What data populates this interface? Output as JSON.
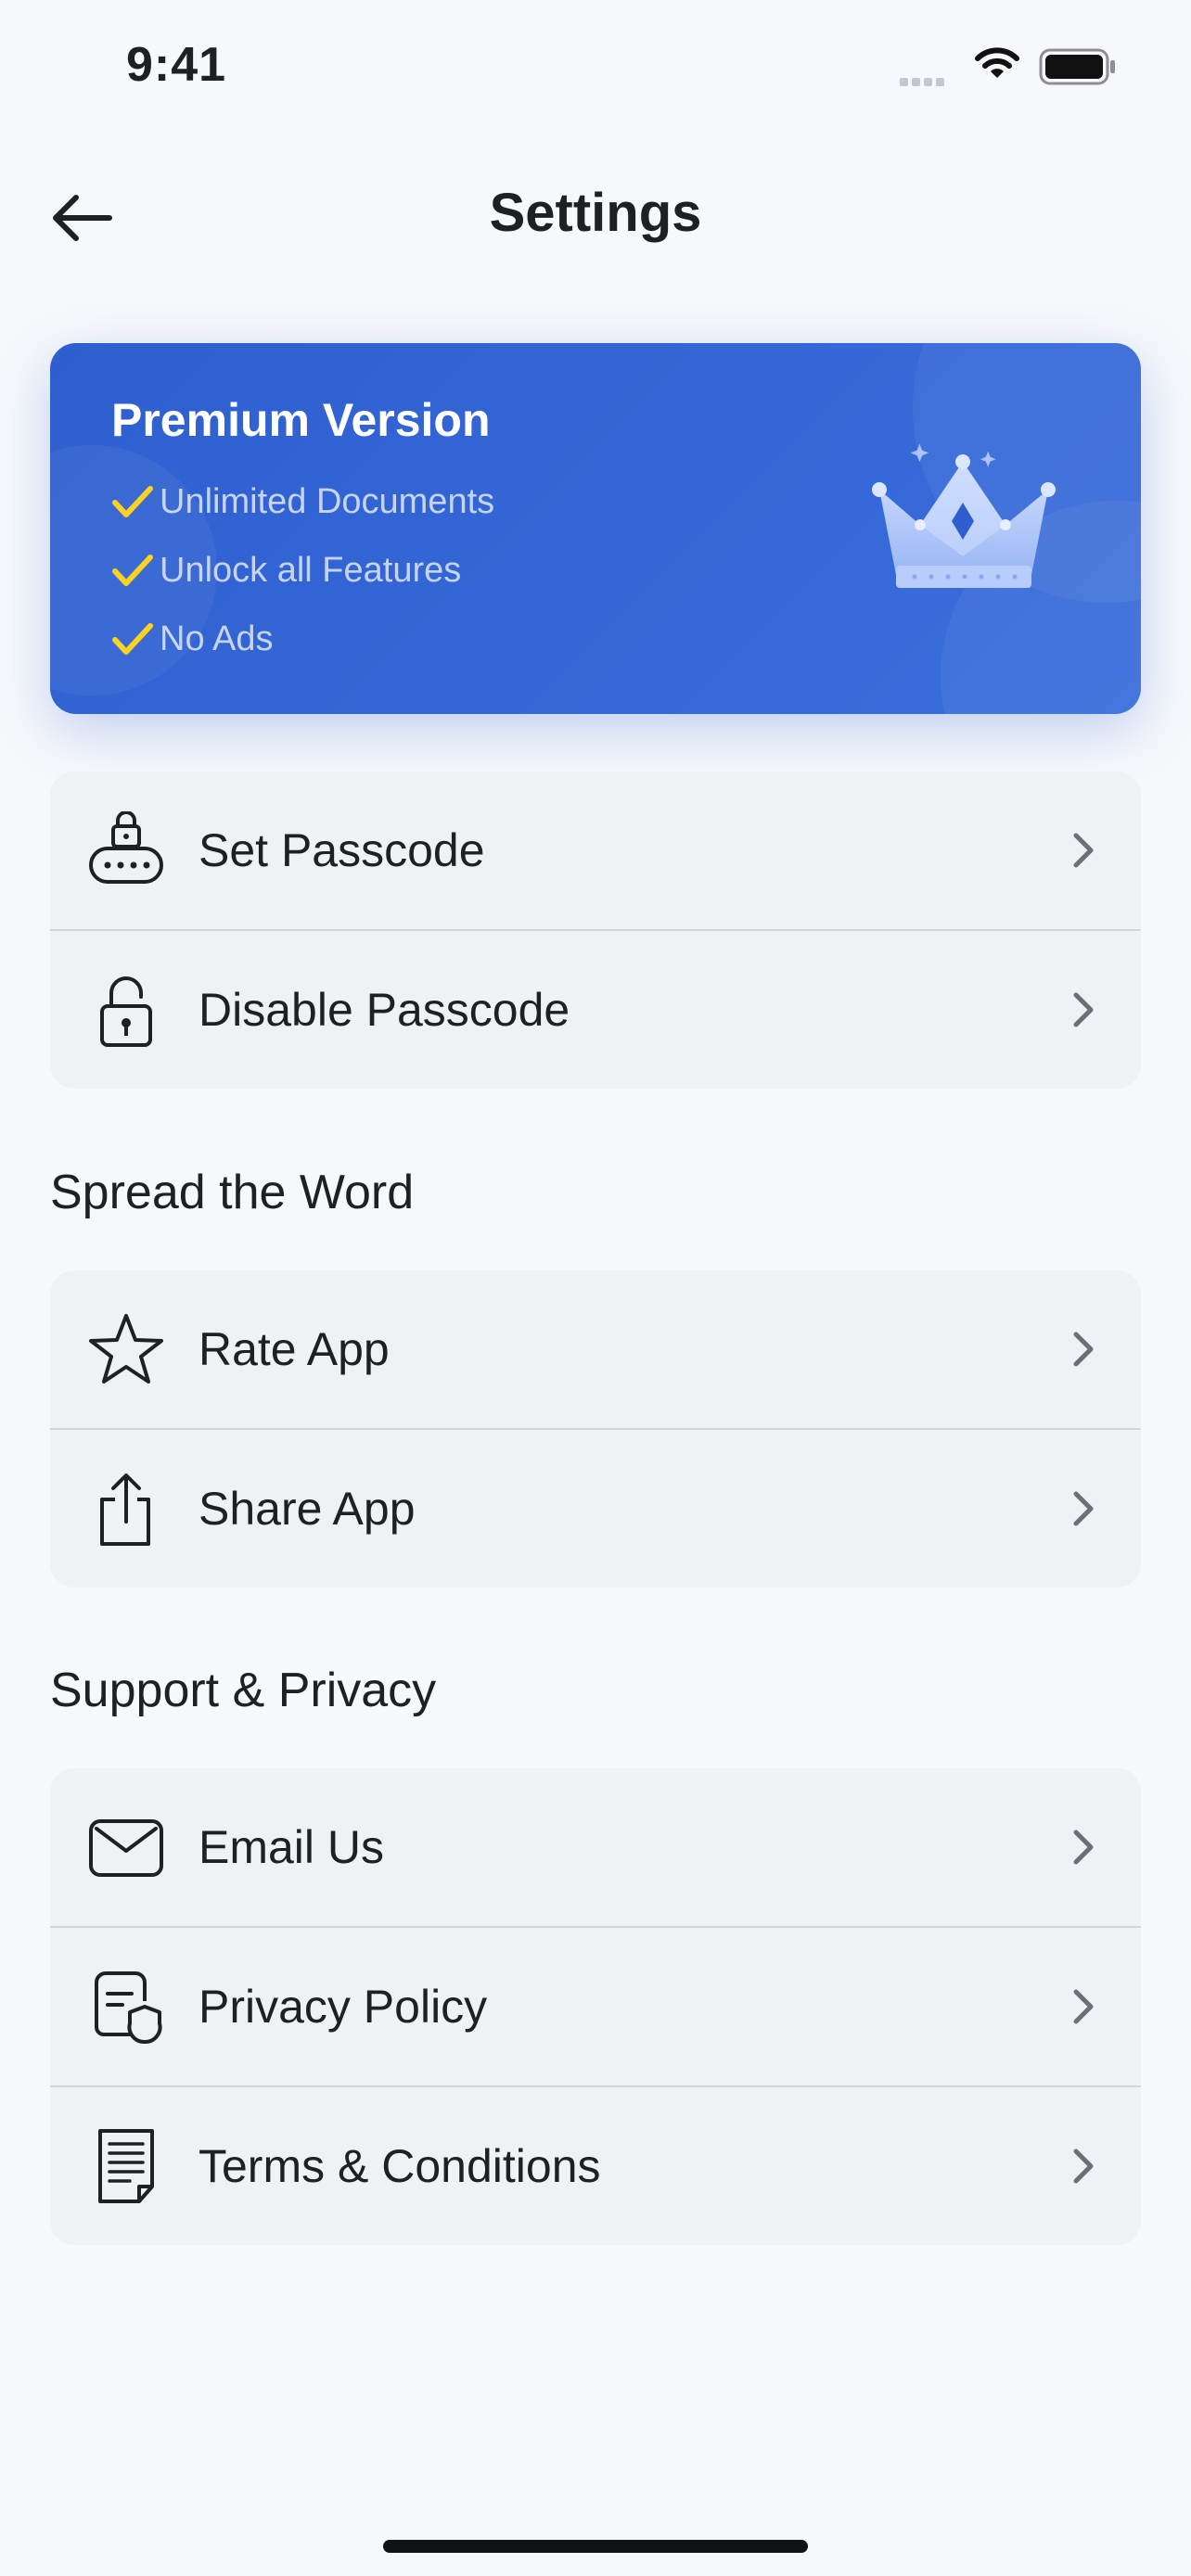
{
  "status_bar": {
    "time": "9:41",
    "icons": [
      "signal-icon",
      "wifi-icon",
      "battery-icon"
    ]
  },
  "header": {
    "title": "Settings",
    "back_icon": "arrow-left-icon"
  },
  "premium": {
    "title": "Premium Version",
    "features": [
      "Unlimited Documents",
      "Unlock all Features",
      "No Ads"
    ],
    "icon": "crown-icon",
    "colors": {
      "background": "#3567d6",
      "check": "#ffd21f"
    }
  },
  "security": {
    "items": [
      {
        "label": "Set Passcode",
        "icon": "passcode-lock-icon"
      },
      {
        "label": "Disable Passcode",
        "icon": "unlock-icon"
      }
    ]
  },
  "spread": {
    "heading": "Spread the Word",
    "items": [
      {
        "label": "Rate App",
        "icon": "star-icon"
      },
      {
        "label": "Share App",
        "icon": "share-icon"
      }
    ]
  },
  "support": {
    "heading": "Support & Privacy",
    "items": [
      {
        "label": "Email Us",
        "icon": "envelope-icon"
      },
      {
        "label": "Privacy Policy",
        "icon": "privacy-shield-icon"
      },
      {
        "label": "Terms & Conditions",
        "icon": "document-icon"
      }
    ]
  }
}
